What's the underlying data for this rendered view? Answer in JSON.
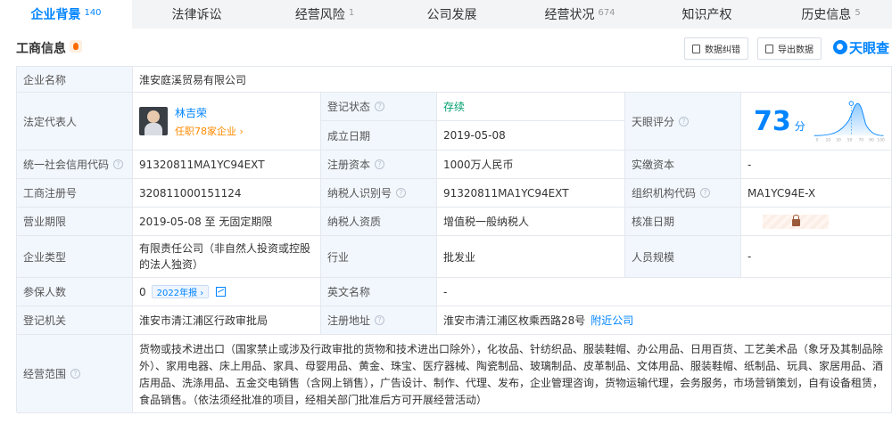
{
  "tabs": [
    {
      "label": "企业背景",
      "count": "140",
      "active": true
    },
    {
      "label": "法律诉讼",
      "count": "",
      "active": false
    },
    {
      "label": "经营风险",
      "count": "1",
      "active": false
    },
    {
      "label": "公司发展",
      "count": "",
      "active": false
    },
    {
      "label": "经营状况",
      "count": "674",
      "active": false
    },
    {
      "label": "知识产权",
      "count": "",
      "active": false
    },
    {
      "label": "历史信息",
      "count": "5",
      "active": false
    }
  ],
  "section": {
    "title": "工商信息",
    "btn_correction": "数据纠错",
    "btn_export": "导出数据",
    "logo_text": "天眼查"
  },
  "info": {
    "company_name_label": "企业名称",
    "company_name": "淮安庭溪贸易有限公司",
    "legal_rep_label": "法定代表人",
    "legal_rep_name": "林吉荣",
    "legal_rep_sub": "任职78家企业 ›",
    "reg_status_label": "登记状态",
    "reg_status": "存续",
    "est_date_label": "成立日期",
    "est_date": "2019-05-08",
    "tianyan_label": "天眼评分",
    "tianyan_score": "73",
    "tianyan_unit": "分",
    "score_axis": [
      "0",
      "10",
      "30",
      "50",
      "70",
      "90",
      "100"
    ],
    "credit_code_label": "统一社会信用代码",
    "credit_code": "91320811MA1YC94EXT",
    "reg_capital_label": "注册资本",
    "reg_capital": "1000万人民币",
    "paid_capital_label": "实缴资本",
    "paid_capital": "-",
    "reg_no_label": "工商注册号",
    "reg_no": "320811000151124",
    "taxpayer_id_label": "纳税人识别号",
    "taxpayer_id": "91320811MA1YC94EXT",
    "org_code_label": "组织机构代码",
    "org_code": "MA1YC94E-X",
    "term_label": "营业期限",
    "term": "2019-05-08 至 无固定期限",
    "taxpayer_qual_label": "纳税人资质",
    "taxpayer_qual": "增值税一般纳税人",
    "approve_date_label": "核准日期",
    "type_label": "企业类型",
    "type": "有限责任公司（非自然人投资或控股的法人独资）",
    "industry_label": "行业",
    "industry": "批发业",
    "staff_label": "人员规模",
    "staff": "-",
    "insured_label": "参保人数",
    "insured": "0",
    "insured_year": "2022年报 ›",
    "en_name_label": "英文名称",
    "en_name": "-",
    "authority_label": "登记机关",
    "authority": "淮安市清江浦区行政审批局",
    "address_label": "注册地址",
    "address": "淮安市清江浦区枚乘西路28号",
    "address_link": "附近公司",
    "scope_label": "经营范围",
    "scope": "货物或技术进出口（国家禁止或涉及行政审批的货物和技术进出口除外），化妆品、针纺织品、服装鞋帽、办公用品、日用百货、工艺美术品（象牙及其制品除外）、家用电器、床上用品、家具、母婴用品、黄金、珠宝、医疗器械、陶瓷制品、玻璃制品、皮革制品、文体用品、服装鞋帽、纸制品、玩具、家居用品、酒店用品、洗涤用品、五金交电销售（含网上销售），广告设计、制作、代理、发布，企业管理咨询，货物运输代理，会务服务，市场营销策划，自有设备租赁，食品销售。（依法须经批准的项目，经相关部门批准后方可开展经营活动）"
  },
  "colors": {
    "accent": "#0084ff",
    "status_green": "#00a06e",
    "label_bg": "#f2f7fd",
    "orange": "#ff8a00"
  }
}
